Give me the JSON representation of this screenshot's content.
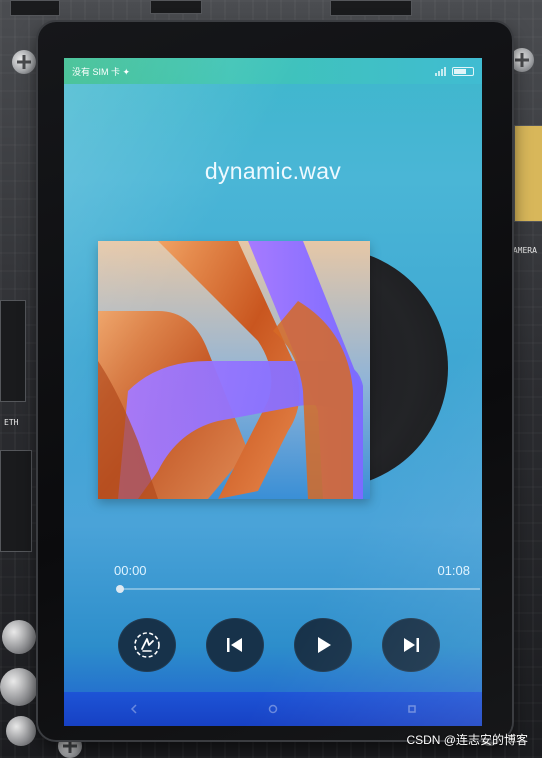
{
  "status_bar": {
    "carrier": "没有 SIM 卡 ✦"
  },
  "player": {
    "title": "dynamic.wav",
    "elapsed": "00:00",
    "total": "01:08",
    "progress": 0.0
  },
  "icons": {
    "play_mode": "shuffle-mode-icon",
    "previous": "skip-previous-icon",
    "play": "play-icon",
    "next": "skip-next-icon"
  },
  "board_labels": {
    "camera": "CAMERA",
    "eth": "ETH"
  },
  "watermark": "CSDN @连志安的博客",
  "colors": {
    "button_bg": "#17324a",
    "accent": "#ffffff"
  }
}
